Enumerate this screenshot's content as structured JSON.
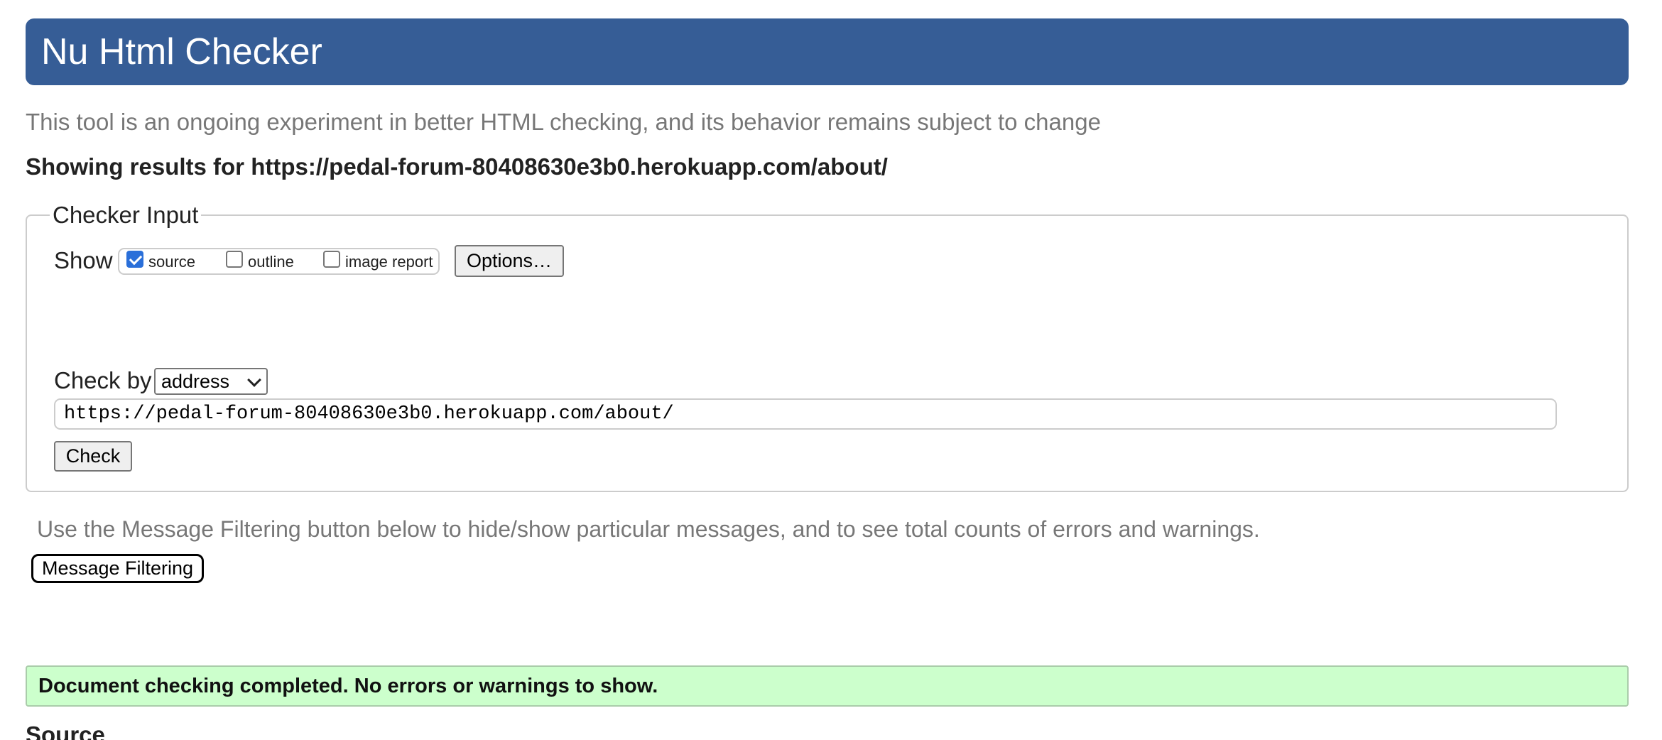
{
  "header": {
    "title": "Nu Html Checker"
  },
  "intro_text": "This tool is an ongoing experiment in better HTML checking, and its behavior remains subject to change",
  "results_for": "Showing results for https://pedal-forum-80408630e3b0.herokuapp.com/about/",
  "checker_input": {
    "legend": "Checker Input",
    "show_label": "Show",
    "show_options": [
      {
        "label": "source",
        "checked": true
      },
      {
        "label": "outline",
        "checked": false
      },
      {
        "label": "image report",
        "checked": false
      }
    ],
    "options_button": "Options…",
    "check_by_label": "Check by",
    "check_by_value": "address",
    "url_value": "https://pedal-forum-80408630e3b0.herokuapp.com/about/",
    "check_button": "Check"
  },
  "filter": {
    "note": "Use the Message Filtering button below to hide/show particular messages, and to see total counts of errors and warnings.",
    "button": "Message Filtering"
  },
  "status": {
    "message": "Document checking completed. No errors or warnings to show."
  },
  "source_heading": "Source",
  "colors": {
    "header_bg": "#365d96",
    "success_bg": "#ccffcc",
    "checkbox_checked": "#2a6fd9"
  }
}
